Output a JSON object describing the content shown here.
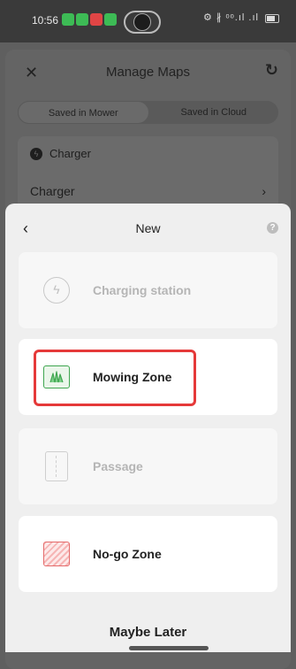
{
  "status_bar": {
    "time": "10:56",
    "right_indicators": "⚙ ∦ ᵒᵒ.ıl .ıl"
  },
  "manage_maps": {
    "title": "Manage Maps",
    "tabs": [
      {
        "label": "Saved in Mower",
        "active": true
      },
      {
        "label": "Saved in Cloud",
        "active": false
      }
    ],
    "section_header": "Charger",
    "row_label": "Charger"
  },
  "new_sheet": {
    "title": "New",
    "options": [
      {
        "label": "Charging station",
        "enabled": false,
        "icon": "charging-station-icon"
      },
      {
        "label": "Mowing Zone",
        "enabled": true,
        "icon": "grass-icon",
        "highlighted": true
      },
      {
        "label": "Passage",
        "enabled": false,
        "icon": "passage-icon"
      },
      {
        "label": "No-go Zone",
        "enabled": true,
        "icon": "no-go-icon"
      }
    ],
    "maybe_later": "Maybe Later"
  },
  "colors": {
    "highlight": "#e53939",
    "mowing_green": "#3fa650",
    "nogo_red": "#e46a6a"
  }
}
